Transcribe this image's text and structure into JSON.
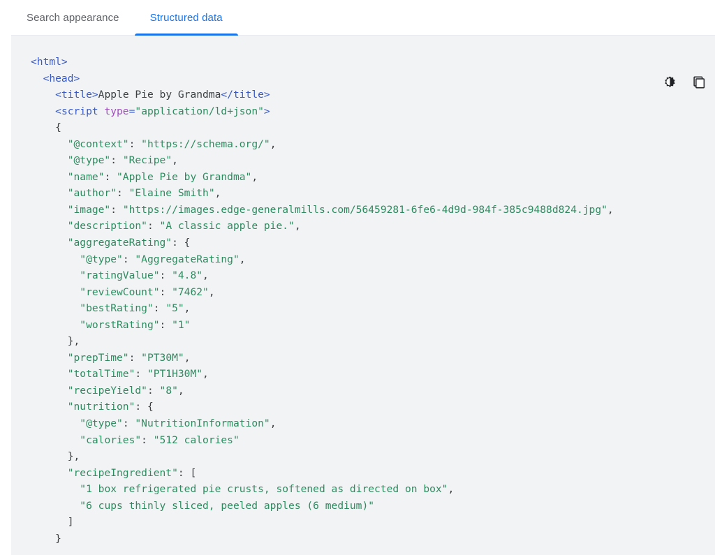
{
  "tabs": [
    {
      "label": "Search appearance",
      "active": false
    },
    {
      "label": "Structured data",
      "active": true
    }
  ],
  "panel": {
    "background_color": "#f1f3f4",
    "accent_color": "#1a73e8",
    "actions": [
      {
        "name": "contrast-icon",
        "label": "Toggle contrast"
      },
      {
        "name": "copy-icon",
        "label": "Copy code"
      }
    ]
  },
  "code": {
    "language": "html",
    "lines": [
      {
        "indent": 0,
        "tokens": [
          {
            "t": "tag",
            "v": "<html>"
          }
        ]
      },
      {
        "indent": 1,
        "tokens": [
          {
            "t": "tag",
            "v": "<head>"
          }
        ]
      },
      {
        "indent": 2,
        "tokens": [
          {
            "t": "tag",
            "v": "<title>"
          },
          {
            "t": "txt",
            "v": "Apple Pie by Grandma"
          },
          {
            "t": "tag",
            "v": "</title>"
          }
        ]
      },
      {
        "indent": 2,
        "tokens": [
          {
            "t": "tag",
            "v": "<script "
          },
          {
            "t": "attr",
            "v": "type"
          },
          {
            "t": "tag",
            "v": "="
          },
          {
            "t": "str",
            "v": "\"application/ld+json\""
          },
          {
            "t": "tag",
            "v": ">"
          }
        ]
      },
      {
        "indent": 2,
        "tokens": [
          {
            "t": "punc",
            "v": "{"
          }
        ]
      },
      {
        "indent": 3,
        "tokens": [
          {
            "t": "str",
            "v": "\"@context\""
          },
          {
            "t": "punc",
            "v": ": "
          },
          {
            "t": "str",
            "v": "\"https://schema.org/\""
          },
          {
            "t": "punc",
            "v": ","
          }
        ]
      },
      {
        "indent": 3,
        "tokens": [
          {
            "t": "str",
            "v": "\"@type\""
          },
          {
            "t": "punc",
            "v": ": "
          },
          {
            "t": "str",
            "v": "\"Recipe\""
          },
          {
            "t": "punc",
            "v": ","
          }
        ]
      },
      {
        "indent": 3,
        "tokens": [
          {
            "t": "str",
            "v": "\"name\""
          },
          {
            "t": "punc",
            "v": ": "
          },
          {
            "t": "str",
            "v": "\"Apple Pie by Grandma\""
          },
          {
            "t": "punc",
            "v": ","
          }
        ]
      },
      {
        "indent": 3,
        "tokens": [
          {
            "t": "str",
            "v": "\"author\""
          },
          {
            "t": "punc",
            "v": ": "
          },
          {
            "t": "str",
            "v": "\"Elaine Smith\""
          },
          {
            "t": "punc",
            "v": ","
          }
        ]
      },
      {
        "indent": 3,
        "tokens": [
          {
            "t": "str",
            "v": "\"image\""
          },
          {
            "t": "punc",
            "v": ": "
          },
          {
            "t": "str",
            "v": "\"https://images.edge-generalmills.com/56459281-6fe6-4d9d-984f-385c9488d824.jpg\""
          },
          {
            "t": "punc",
            "v": ","
          }
        ]
      },
      {
        "indent": 3,
        "tokens": [
          {
            "t": "str",
            "v": "\"description\""
          },
          {
            "t": "punc",
            "v": ": "
          },
          {
            "t": "str",
            "v": "\"A classic apple pie.\""
          },
          {
            "t": "punc",
            "v": ","
          }
        ]
      },
      {
        "indent": 3,
        "tokens": [
          {
            "t": "str",
            "v": "\"aggregateRating\""
          },
          {
            "t": "punc",
            "v": ": {"
          }
        ]
      },
      {
        "indent": 4,
        "tokens": [
          {
            "t": "str",
            "v": "\"@type\""
          },
          {
            "t": "punc",
            "v": ": "
          },
          {
            "t": "str",
            "v": "\"AggregateRating\""
          },
          {
            "t": "punc",
            "v": ","
          }
        ]
      },
      {
        "indent": 4,
        "tokens": [
          {
            "t": "str",
            "v": "\"ratingValue\""
          },
          {
            "t": "punc",
            "v": ": "
          },
          {
            "t": "str",
            "v": "\"4.8\""
          },
          {
            "t": "punc",
            "v": ","
          }
        ]
      },
      {
        "indent": 4,
        "tokens": [
          {
            "t": "str",
            "v": "\"reviewCount\""
          },
          {
            "t": "punc",
            "v": ": "
          },
          {
            "t": "str",
            "v": "\"7462\""
          },
          {
            "t": "punc",
            "v": ","
          }
        ]
      },
      {
        "indent": 4,
        "tokens": [
          {
            "t": "str",
            "v": "\"bestRating\""
          },
          {
            "t": "punc",
            "v": ": "
          },
          {
            "t": "str",
            "v": "\"5\""
          },
          {
            "t": "punc",
            "v": ","
          }
        ]
      },
      {
        "indent": 4,
        "tokens": [
          {
            "t": "str",
            "v": "\"worstRating\""
          },
          {
            "t": "punc",
            "v": ": "
          },
          {
            "t": "str",
            "v": "\"1\""
          }
        ]
      },
      {
        "indent": 3,
        "tokens": [
          {
            "t": "punc",
            "v": "},"
          }
        ]
      },
      {
        "indent": 3,
        "tokens": [
          {
            "t": "str",
            "v": "\"prepTime\""
          },
          {
            "t": "punc",
            "v": ": "
          },
          {
            "t": "str",
            "v": "\"PT30M\""
          },
          {
            "t": "punc",
            "v": ","
          }
        ]
      },
      {
        "indent": 3,
        "tokens": [
          {
            "t": "str",
            "v": "\"totalTime\""
          },
          {
            "t": "punc",
            "v": ": "
          },
          {
            "t": "str",
            "v": "\"PT1H30M\""
          },
          {
            "t": "punc",
            "v": ","
          }
        ]
      },
      {
        "indent": 3,
        "tokens": [
          {
            "t": "str",
            "v": "\"recipeYield\""
          },
          {
            "t": "punc",
            "v": ": "
          },
          {
            "t": "str",
            "v": "\"8\""
          },
          {
            "t": "punc",
            "v": ","
          }
        ]
      },
      {
        "indent": 3,
        "tokens": [
          {
            "t": "str",
            "v": "\"nutrition\""
          },
          {
            "t": "punc",
            "v": ": {"
          }
        ]
      },
      {
        "indent": 4,
        "tokens": [
          {
            "t": "str",
            "v": "\"@type\""
          },
          {
            "t": "punc",
            "v": ": "
          },
          {
            "t": "str",
            "v": "\"NutritionInformation\""
          },
          {
            "t": "punc",
            "v": ","
          }
        ]
      },
      {
        "indent": 4,
        "tokens": [
          {
            "t": "str",
            "v": "\"calories\""
          },
          {
            "t": "punc",
            "v": ": "
          },
          {
            "t": "str",
            "v": "\"512 calories\""
          }
        ]
      },
      {
        "indent": 3,
        "tokens": [
          {
            "t": "punc",
            "v": "},"
          }
        ]
      },
      {
        "indent": 3,
        "tokens": [
          {
            "t": "str",
            "v": "\"recipeIngredient\""
          },
          {
            "t": "punc",
            "v": ": ["
          }
        ]
      },
      {
        "indent": 4,
        "tokens": [
          {
            "t": "str",
            "v": "\"1 box refrigerated pie crusts, softened as directed on box\""
          },
          {
            "t": "punc",
            "v": ","
          }
        ]
      },
      {
        "indent": 4,
        "tokens": [
          {
            "t": "str",
            "v": "\"6 cups thinly sliced, peeled apples (6 medium)\""
          }
        ]
      },
      {
        "indent": 3,
        "tokens": [
          {
            "t": "punc",
            "v": "]"
          }
        ]
      },
      {
        "indent": 2,
        "tokens": [
          {
            "t": "punc",
            "v": "}"
          }
        ]
      }
    ]
  }
}
